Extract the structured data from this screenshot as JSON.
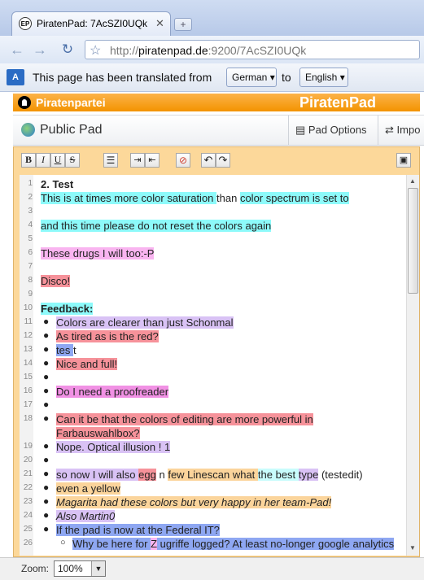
{
  "browser": {
    "tab_title": "PiratenPad: 7AcSZI0UQk",
    "favicon_text": "EP",
    "url_scheme": "http://",
    "url_domain": "piratenpad.de",
    "url_rest": ":9200/7AcSZI0UQk"
  },
  "translate_bar": {
    "prefix": "This page has been translated from",
    "from_language": "German",
    "connector": "to",
    "to_language": "English"
  },
  "site": {
    "party_name": "Piratenpartei",
    "brand": "PiratenPad"
  },
  "pad": {
    "name": "Public Pad",
    "options_label": "Pad Options",
    "import_label": "Impo"
  },
  "editor_toolbar": {
    "bold": "B",
    "italic": "I",
    "underline": "U",
    "strike": "S"
  },
  "lines": [
    {
      "n": "1",
      "parts": [
        {
          "t": "2. Test",
          "c": "",
          "s": "b"
        }
      ]
    },
    {
      "n": "2",
      "parts": [
        {
          "t": "This is at times more color saturation ",
          "c": "cyan"
        },
        {
          "t": "than ",
          "c": ""
        },
        {
          "t": "color spectrum is set to",
          "c": "cyan"
        }
      ]
    },
    {
      "n": "3",
      "parts": []
    },
    {
      "n": "4",
      "parts": [
        {
          "t": "and this time please do not reset the colors again",
          "c": "cyan"
        }
      ]
    },
    {
      "n": "5",
      "parts": []
    },
    {
      "n": "6",
      "parts": [
        {
          "t": "These drugs I will too:-P",
          "c": "pink"
        }
      ]
    },
    {
      "n": "7",
      "parts": []
    },
    {
      "n": "8",
      "parts": [
        {
          "t": "Disco!",
          "c": "red"
        }
      ]
    },
    {
      "n": "9",
      "parts": []
    },
    {
      "n": "10",
      "parts": [
        {
          "t": "Feedback:",
          "c": "cyan",
          "s": "b"
        }
      ]
    },
    {
      "n": "11",
      "bullet": true,
      "parts": [
        {
          "t": "Colors are clearer than just Schonmal",
          "c": "lav"
        }
      ]
    },
    {
      "n": "12",
      "bullet": true,
      "parts": [
        {
          "t": "As tired as is the red?",
          "c": "red"
        }
      ]
    },
    {
      "n": "13",
      "bullet": true,
      "parts": [
        {
          "t": "tes ",
          "c": "blue"
        },
        {
          "t": "t",
          "c": ""
        }
      ]
    },
    {
      "n": "14",
      "bullet": true,
      "parts": [
        {
          "t": "Nice and full!",
          "c": "red"
        }
      ]
    },
    {
      "n": "15",
      "bullet": true,
      "parts": []
    },
    {
      "n": "16",
      "bullet": true,
      "parts": [
        {
          "t": "Do I need a proofreader",
          "c": "magenta"
        }
      ]
    },
    {
      "n": "17",
      "bullet": true,
      "parts": []
    },
    {
      "n": "18",
      "bullet": true,
      "parts": [
        {
          "t": "Can it be that the colors of editing are more powerful in ",
          "c": "red"
        }
      ]
    },
    {
      "n": "",
      "cont": true,
      "parts": [
        {
          "t": "Farbauswahlbox?",
          "c": "red"
        }
      ]
    },
    {
      "n": "19",
      "bullet": true,
      "parts": [
        {
          "t": "Nope. Optical illusion ! 1",
          "c": "lav"
        }
      ]
    },
    {
      "n": "20",
      "bullet": true,
      "parts": []
    },
    {
      "n": "21",
      "bullet": true,
      "parts": [
        {
          "t": "so now I will also ",
          "c": "lav"
        },
        {
          "t": "egg",
          "c": "red"
        },
        {
          "t": " n ",
          "c": ""
        },
        {
          "t": " few Linescan what ",
          "c": "yel"
        },
        {
          "t": "the best ",
          "c": "lcyan"
        },
        {
          "t": "type",
          "c": "lav"
        },
        {
          "t": " (testedit)",
          "c": ""
        }
      ]
    },
    {
      "n": "22",
      "bullet": true,
      "parts": [
        {
          "t": "even a yellow",
          "c": "yel"
        }
      ]
    },
    {
      "n": "23",
      "bullet": true,
      "parts": [
        {
          "t": "Magarita had these colors but very happy in her team-Pad!",
          "c": "yel",
          "s": "i"
        }
      ]
    },
    {
      "n": "24",
      "bullet": true,
      "parts": [
        {
          "t": "Also Martin0",
          "c": "lav",
          "s": "i"
        }
      ]
    },
    {
      "n": "25",
      "bullet": true,
      "parts": [
        {
          "t": "If the pad is now at the Federal IT?",
          "c": "blue"
        }
      ]
    },
    {
      "n": "26",
      "sub": true,
      "parts": [
        {
          "t": "Why be here for ",
          "c": "blue"
        },
        {
          "t": "Z",
          "c": "pink"
        },
        {
          "t": " ugriffe logged? At least no-longer google analytics",
          "c": "blue"
        }
      ]
    }
  ],
  "zoom": {
    "label": "Zoom:",
    "value": "100%"
  }
}
